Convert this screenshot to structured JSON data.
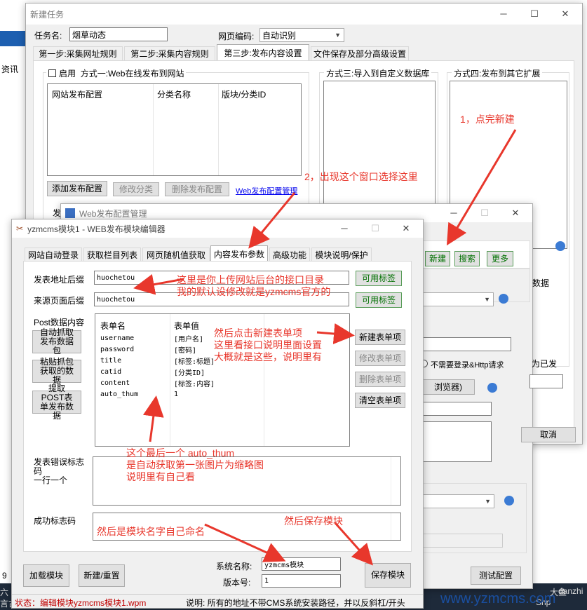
{
  "background": {
    "left_text": "资讯",
    "right_text": "danzhi",
    "right_text2": "大鱼",
    "left_status": "9",
    "left_bottom": "六",
    "left_bottom2": "言古",
    "right_status": "Shp"
  },
  "task_window": {
    "title": "新建任务",
    "task_name_label": "任务名:",
    "task_name_value": "烟草动态",
    "encoding_label": "网页编码:",
    "encoding_value": "自动识别",
    "tabs": [
      "第一步:采集网址规则",
      "第二步:采集内容规则",
      "第三步:发布内容设置",
      "文件保存及部分高级设置"
    ],
    "enable_label": "启用",
    "method1_label": "方式一:Web在线发布到网站",
    "table_headers": [
      "网站发布配置",
      "分类名称",
      "版块/分类ID"
    ],
    "buttons": {
      "add": "添加发布配置",
      "edit": "修改分类",
      "delete": "删除发布配置"
    },
    "manage_link": "Web发布配置管理",
    "method3_label": "方式三:导入到自定义数据库",
    "method4_label": "方式四:发布到其它扩展",
    "partial_label": "发"
  },
  "config_window": {
    "title": "Web发布配置管理",
    "toolbar": {
      "new": "新建",
      "search": "搜索",
      "more": "更多"
    },
    "fragments": {
      "data": "数据",
      "no_login": "不需要登录&Http请求",
      "published": "为已发",
      "browser": "浏览器)"
    },
    "cancel": "取消",
    "test": "测试配置"
  },
  "editor": {
    "title": "yzmcms模块1 - WEB发布模块编辑器",
    "tabs": [
      "网站自动登录",
      "获取栏目列表",
      "网页随机值获取",
      "内容发布参数",
      "高级功能",
      "模块说明/保护"
    ],
    "post_url_label": "发表地址后缀",
    "post_url_value": "huochetou",
    "referer_label": "来源页面后缀",
    "referer_value": "huochetou",
    "available_tags": "可用标签",
    "post_data_label": "Post数据内容",
    "left_buttons": [
      "自动抓取发布数据包",
      "粘贴抓包获取的数据",
      "提取POST表单发布数据"
    ],
    "table": {
      "headers": [
        "表单名",
        "表单值"
      ],
      "rows": [
        [
          "username",
          "[用户名]"
        ],
        [
          "password",
          "[密码]"
        ],
        [
          "title",
          "[标签:标题]"
        ],
        [
          "catid",
          "[分类ID]"
        ],
        [
          "content",
          "[标签:内容]"
        ],
        [
          "auto_thum",
          "1"
        ]
      ]
    },
    "right_buttons": {
      "new": "新建表单项",
      "edit": "修改表单项",
      "delete": "删除表单项",
      "clear": "清空表单项"
    },
    "error_label": "发表错误标志码\n一行一个",
    "success_label": "成功标志码",
    "load": "加载模块",
    "new_reset": "新建/重置",
    "system_name_label": "系统名称:",
    "system_name_value": "yzmcms模块",
    "version_label": "版本号:",
    "version_value": "1",
    "save": "保存模块",
    "status": "状态：编辑模块yzmcms模块1.wpm",
    "status_note": "说明: 所有的地址不带CMS系统安装路径，并以反斜杠/开头"
  },
  "annotations": {
    "a1": "1，点完新建",
    "a2": "2，出现这个窗口选择这里",
    "a3": "这里是你上传网站后台的接口目录\n我的默认设修改就是yzmcms官方的",
    "a4": "然后点击新建表单项\n这里看接口说明里面设置\n大概就是这些，说明里有",
    "a5": "这个最后一个 auto_thum\n是自动获取第一张图片为缩略图\n说明里有自己看",
    "a6": "然后是模块名字自己命名",
    "a7": "然后保存模块"
  },
  "watermark": "www.yzmcms.com",
  "colors": {
    "annotation": "#e8372c",
    "watermark": "#1a4fa0",
    "link": "#0000ee",
    "status_red": "#c00000"
  }
}
